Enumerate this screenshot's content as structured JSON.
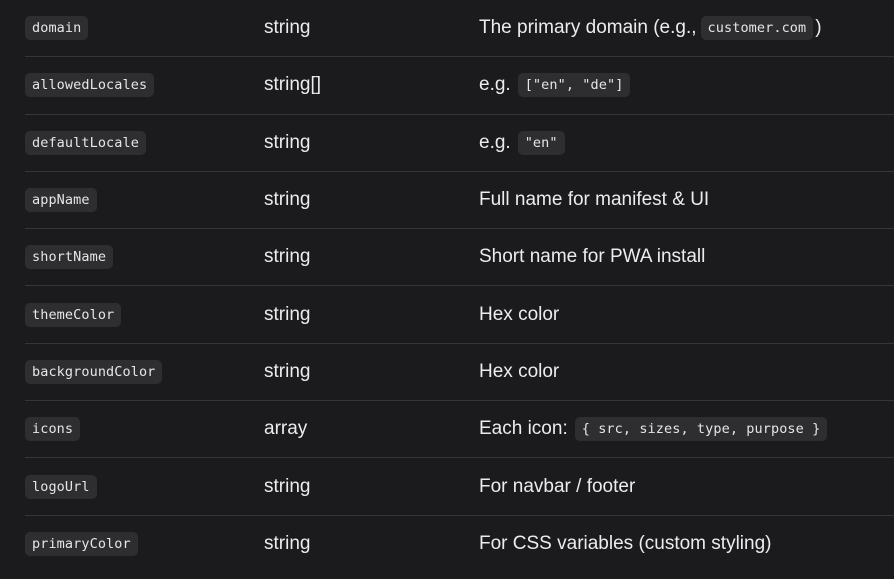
{
  "rows": [
    {
      "name": "domain",
      "type": "string",
      "desc_pre": "The primary domain (e.g.,",
      "desc_code": "customer.com",
      "desc_post": ")"
    },
    {
      "name": "allowedLocales",
      "type": "string[]",
      "desc_pre": "e.g.",
      "desc_code": "[\"en\", \"de\"]",
      "desc_post": ""
    },
    {
      "name": "defaultLocale",
      "type": "string",
      "desc_pre": "e.g.",
      "desc_code": "\"en\"",
      "desc_post": ""
    },
    {
      "name": "appName",
      "type": "string",
      "desc_pre": "Full name for manifest & UI",
      "desc_code": "",
      "desc_post": ""
    },
    {
      "name": "shortName",
      "type": "string",
      "desc_pre": "Short name for PWA install",
      "desc_code": "",
      "desc_post": ""
    },
    {
      "name": "themeColor",
      "type": "string",
      "desc_pre": "Hex color",
      "desc_code": "",
      "desc_post": ""
    },
    {
      "name": "backgroundColor",
      "type": "string",
      "desc_pre": "Hex color",
      "desc_code": "",
      "desc_post": ""
    },
    {
      "name": "icons",
      "type": "array",
      "desc_pre": "Each icon:",
      "desc_code": "{ src, sizes, type, purpose }",
      "desc_post": ""
    },
    {
      "name": "logoUrl",
      "type": "string",
      "desc_pre": "For navbar / footer",
      "desc_code": "",
      "desc_post": ""
    },
    {
      "name": "primaryColor",
      "type": "string",
      "desc_pre": "For CSS variables (custom styling)",
      "desc_code": "",
      "desc_post": ""
    }
  ]
}
